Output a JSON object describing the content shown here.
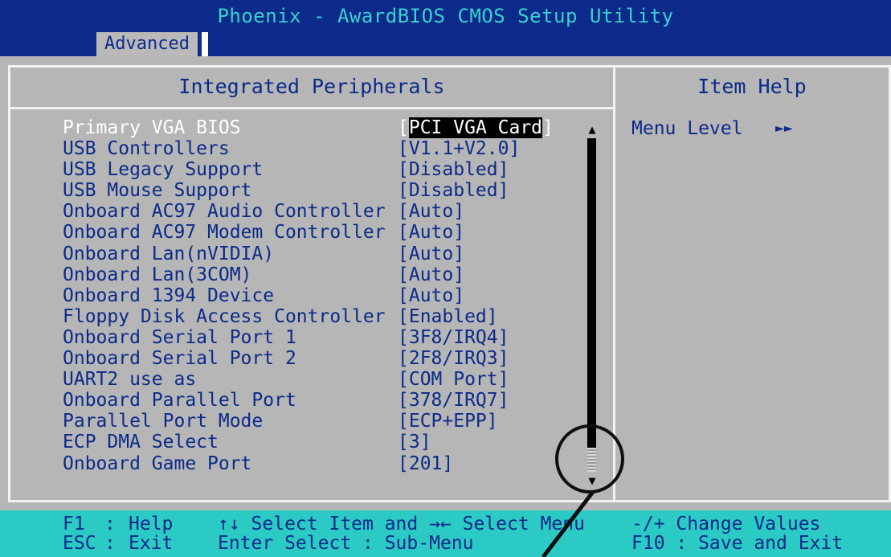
{
  "window": {
    "title": "Phoenix - AwardBIOS CMOS Setup Utility",
    "tab": "Advanced"
  },
  "section": {
    "title": "Integrated Peripherals"
  },
  "help": {
    "title": "Item Help",
    "menu_level": "Menu Level",
    "menu_level_arrow": "►►"
  },
  "items": [
    {
      "label": "Primary VGA BIOS",
      "value_open": "[",
      "value": "PCI VGA Card",
      "value_close": "]"
    },
    {
      "label": "USB Controllers",
      "value": "[V1.1+V2.0]"
    },
    {
      "label": "USB Legacy Support",
      "value": "[Disabled]"
    },
    {
      "label": "USB Mouse Support",
      "value": "[Disabled]"
    },
    {
      "label": "Onboard AC97 Audio Controller",
      "value": "[Auto]"
    },
    {
      "label": "Onboard AC97 Modem Controller",
      "value": "[Auto]"
    },
    {
      "label": "Onboard Lan(nVIDIA)",
      "value": "[Auto]"
    },
    {
      "label": "Onboard Lan(3COM)",
      "value": "[Auto]"
    },
    {
      "label": "Onboard 1394 Device",
      "value": "[Auto]"
    },
    {
      "label": "Floppy Disk Access Controller",
      "value": "[Enabled]"
    },
    {
      "label": "Onboard Serial Port 1",
      "value": "[3F8/IRQ4]"
    },
    {
      "label": "Onboard Serial Port 2",
      "value": "[2F8/IRQ3]"
    },
    {
      "label": "UART2 use as",
      "value": "[COM Port]"
    },
    {
      "label": "Onboard Parallel Port",
      "value": "[378/IRQ7]"
    },
    {
      "label": "Parallel Port Mode",
      "value": "[ECP+EPP]"
    },
    {
      "label": "ECP DMA Select",
      "value": "[3]"
    },
    {
      "label": "Onboard Game Port",
      "value": "[201]"
    }
  ],
  "scrollbar": {
    "up_glyph": "▲",
    "down_glyph": "▼"
  },
  "footer": {
    "f1_key": "F1",
    "f1_sep": ":",
    "f1_action": "Help",
    "nav_line1": "↑↓ Select Item and →← Select Menu",
    "change_values": "-/+ Change Values",
    "esc_key": "ESC",
    "esc_sep": ":",
    "esc_action": "Exit",
    "nav_line2": "Enter Select : Sub-Menu",
    "f10_line": "F10 : Save and Exit"
  },
  "colors": {
    "bios_blue": "#0b2a8a",
    "title_cyan": "#38d2cf",
    "panel_gray": "#b6b6b6",
    "footer_cyan": "#2ccac4",
    "highlight_black": "#000000"
  }
}
